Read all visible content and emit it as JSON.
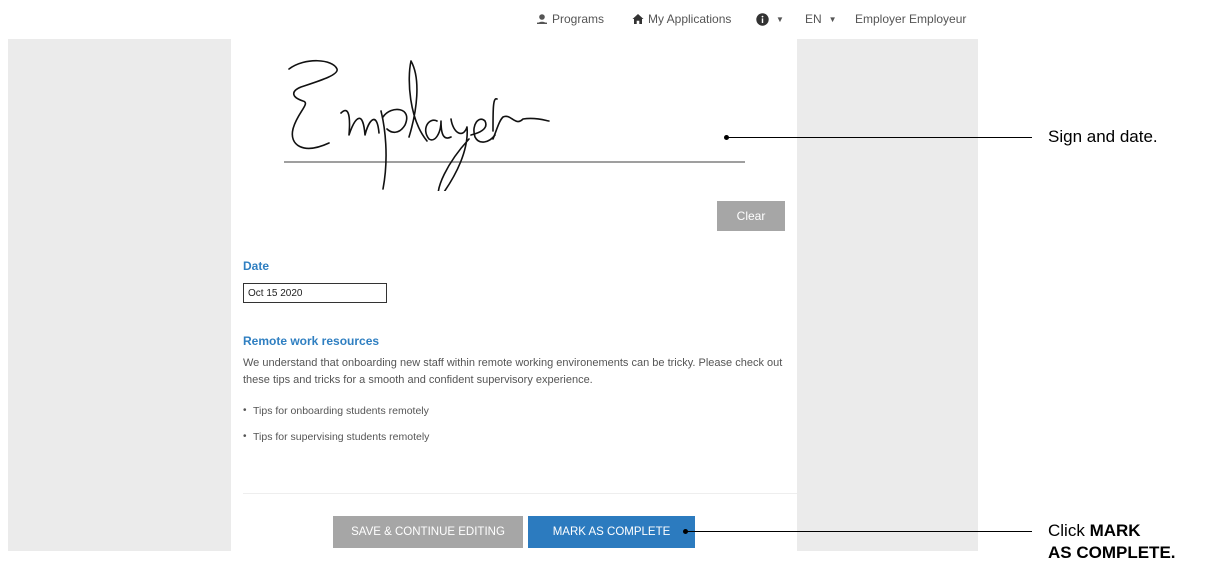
{
  "nav": {
    "programs_label": "Programs",
    "applications_label": "My Applications",
    "language_label": "EN",
    "user_label": "Employer Employeur",
    "icons": [
      "graduation-cap-icon",
      "home-icon",
      "info-icon",
      "caret-down-icon"
    ]
  },
  "signature": {
    "signature_text": "Employer",
    "clear_label": "Clear"
  },
  "date_section": {
    "heading": "Date",
    "value": "Oct 15 2020"
  },
  "remote_resources": {
    "heading": "Remote work resources",
    "description": "We understand that onboarding new staff within remote working environements can be tricky. Please check out these tips and tricks for a smooth and confident supervisory experience.",
    "tips": [
      "Tips for onboarding students remotely",
      "Tips for supervising students remotely"
    ]
  },
  "actions": {
    "save_label": "SAVE & CONTINUE EDITING",
    "complete_label": "MARK AS COMPLETE"
  },
  "annotations": {
    "sign_callout": "Sign and date.",
    "complete_prefix": "Click",
    "complete_bold_1": "MARK",
    "complete_bold_2": "AS COMPLETE."
  },
  "colors": {
    "accent": "#2c7bbf",
    "heading": "#2f7fc1",
    "muted_button": "#a6a6a6",
    "panel": "#ebebeb"
  }
}
